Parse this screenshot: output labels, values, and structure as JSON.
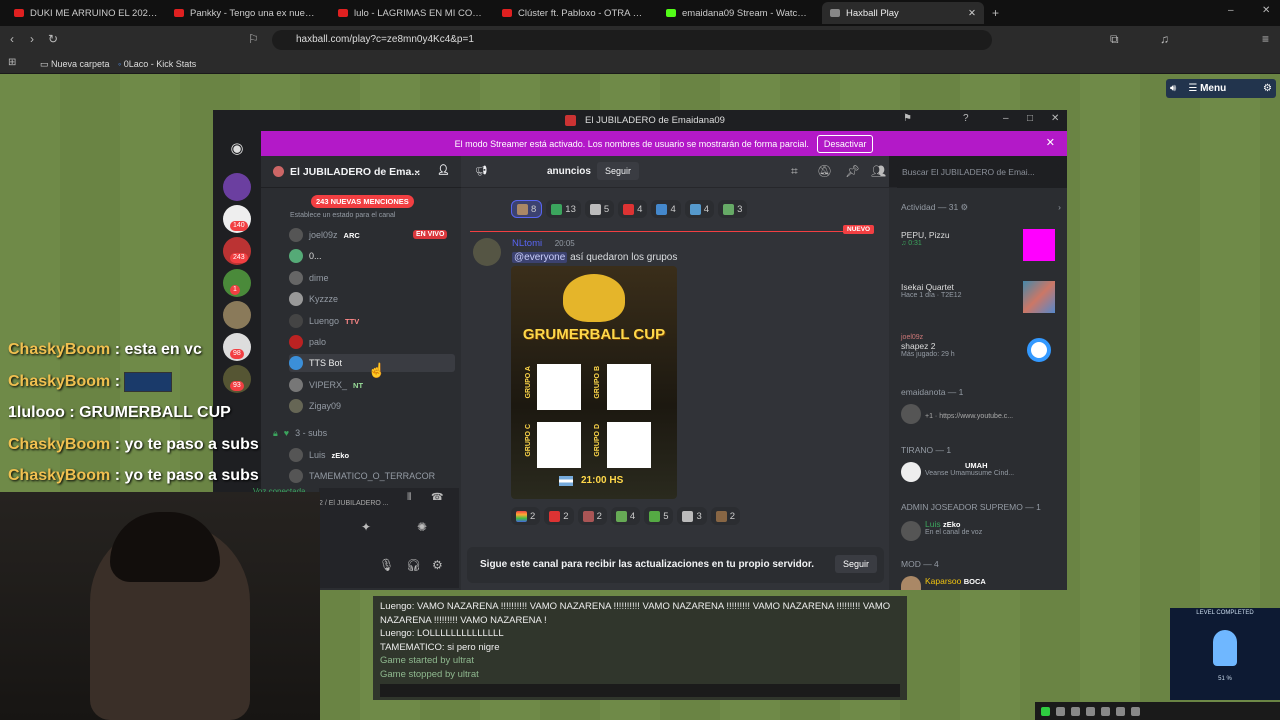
{
  "browser": {
    "tabs": [
      {
        "label": "DUKI ME ARRUINO EL 2026 (complete...",
        "color": "#e02020"
      },
      {
        "label": "Pankky - Tengo una ex nueva - YouT...",
        "color": "#e02020"
      },
      {
        "label": "lulo - LAGRIMAS EN MI COPA #1MIL...",
        "color": "#e02020"
      },
      {
        "label": "Clúster ft. Pabloxo - OTRA SEDA ...",
        "color": "#e02020"
      },
      {
        "label": "emaidana09 Stream - Watch Live on...",
        "color": "#53fc18"
      },
      {
        "label": "Haxball Play",
        "color": "#888888"
      }
    ],
    "url": "haxball.com/play?c=ze8mn0y4Kc4&p=1",
    "bookmarks": [
      "Nueva carpeta",
      "0Laco - Kick Stats"
    ]
  },
  "game_controls": {
    "menu_label": "Menu"
  },
  "discord": {
    "window_title": "El JUBILADERO de Emaidana09",
    "banner_text": "El modo Streamer está activado. Los nombres de usuario se mostrarán de forma parcial.",
    "banner_button": "Desactivar",
    "server_badges": [
      "140",
      "243",
      "1",
      "98",
      "93"
    ],
    "server_name": "El JUBILADERO de Ema...",
    "mentions_label": "243 NUEVAS MENCIONES",
    "status_hint": "Establece un estado para el canal",
    "voice_members": [
      {
        "name": "joel09z",
        "tag": "ARC",
        "live": "EN VIVO"
      },
      {
        "name": "0...",
        "tag": ""
      },
      {
        "name": "dime",
        "tag": ""
      },
      {
        "name": "Kyzzze",
        "tag": ""
      },
      {
        "name": "Luengo",
        "tag": "TTV"
      },
      {
        "name": "palo",
        "tag": ""
      },
      {
        "name": "TTS Bot",
        "tag": ""
      },
      {
        "name": "VIPERX_",
        "tag": "NT"
      },
      {
        "name": "Zigay09",
        "tag": ""
      }
    ],
    "subs_channel": "3 - subs",
    "subs_members": [
      {
        "name": "Luis",
        "tag": "zEko"
      },
      {
        "name": "TAMEMATICO_O_TERRACOR",
        "tag": ""
      }
    ],
    "voice_connected": "Voz conectada",
    "voice_path": "2 / El JUBILADERO ...",
    "channel_name": "anuncios",
    "follow_label": "Seguir",
    "search_placeholder": "Buscar El JUBILADERO de Emai...",
    "reactions_top": [
      "8",
      "13",
      "5",
      "4",
      "4",
      "4",
      "3"
    ],
    "new_label": "NUEVO",
    "message": {
      "author": "NLtomi",
      "time": "20:05",
      "mention": "@everyone",
      "text": "así quedaron los grupos"
    },
    "poster": {
      "title": "GRUMERBALL CUP",
      "groups": [
        "GRUPO A",
        "GRUPO B",
        "GRUPO C",
        "GRUPO D"
      ],
      "time": "21:00 HS"
    },
    "reactions_bottom": [
      "2",
      "2",
      "2",
      "4",
      "5",
      "3",
      "2"
    ],
    "follow_prompt": "Sigue este canal para recibir las actualizaciones en tu propio servidor.",
    "activity": {
      "header": "Actividad — 31",
      "items": [
        {
          "name": "PEPU, Pizzu",
          "sub": "0:31"
        },
        {
          "name": "Isekai Quartet",
          "sub": "Hace 1 día · T2E12"
        },
        {
          "name": "shapez 2",
          "sub": "Más jugado: 29 h",
          "user": "joel09z"
        }
      ],
      "groups": [
        {
          "header": "emaidanota — 1",
          "detail": "+1 · https://www.youtube.c..."
        },
        {
          "header": "TIRANO — 1",
          "detail": "Veanse Umamusume Cind...",
          "tag": "UMAH"
        },
        {
          "header": "ADMIN JOSEADOR SUPREMO — 1",
          "name": "Luis",
          "tag": "zEko",
          "detail": "En el canal de voz"
        },
        {
          "header": "MOD — 4",
          "name": "Kaparsoo",
          "tag": "BOCA"
        }
      ]
    }
  },
  "overlay_chat": [
    {
      "user": "ChaskyBoom",
      "text": "esta en vc"
    },
    {
      "user": "ChaskyBoom",
      "text": ""
    },
    {
      "user": "1lulooo",
      "text": "GRUMERBALL CUP"
    },
    {
      "user": "ChaskyBoom",
      "text": "yo te paso a subs"
    },
    {
      "user": "ChaskyBoom",
      "text": "yo te paso a subs"
    }
  ],
  "haxball_chat": [
    {
      "text": "Luengo: VAMO NAZARENA !!!!!!!!!! VAMO NAZARENA !!!!!!!!!! VAMO NAZARENA !!!!!!!!! VAMO NAZARENA !!!!!!!!! VAMO NAZARENA !!!!!!!!! VAMO NAZARENA !",
      "sys": false
    },
    {
      "text": "Luengo: LOLLLLLLLLLLLLLL",
      "sys": false
    },
    {
      "text": "TAMEMATICO: si pero nigre",
      "sys": false
    },
    {
      "text": "Game started by ultrat",
      "sys": true
    },
    {
      "text": "Game stopped by ultrat",
      "sys": true
    }
  ],
  "level_widget": {
    "title": "LEVEL COMPLETED",
    "percent": "51 %"
  }
}
